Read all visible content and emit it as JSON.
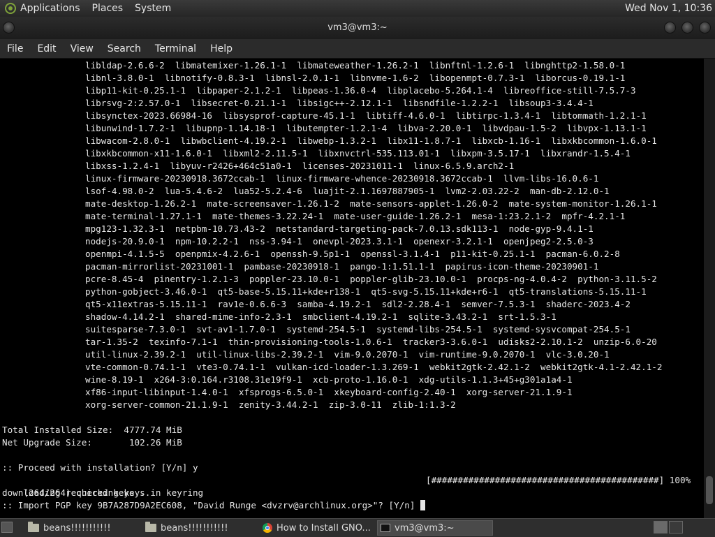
{
  "top_panel": {
    "menus": [
      "Applications",
      "Places",
      "System"
    ],
    "clock": "Wed Nov 1, 10:36"
  },
  "window": {
    "title": "vm3@vm3:~"
  },
  "menubar": [
    "File",
    "Edit",
    "View",
    "Search",
    "Terminal",
    "Help"
  ],
  "terminal": {
    "package_lines": [
      "libldap-2.6.6-2  libmatemixer-1.26.1-1  libmateweather-1.26.2-1  libnftnl-1.2.6-1  libnghttp2-1.58.0-1",
      "libnl-3.8.0-1  libnotify-0.8.3-1  libnsl-2.0.1-1  libnvme-1.6-2  libopenmpt-0.7.3-1  liborcus-0.19.1-1",
      "libp11-kit-0.25.1-1  libpaper-2.1.2-1  libpeas-1.36.0-4  libplacebo-5.264.1-4  libreoffice-still-7.5.7-3",
      "librsvg-2:2.57.0-1  libsecret-0.21.1-1  libsigc++-2.12.1-1  libsndfile-1.2.2-1  libsoup3-3.4.4-1",
      "libsynctex-2023.66984-16  libsysprof-capture-45.1-1  libtiff-4.6.0-1  libtirpc-1.3.4-1  libtommath-1.2.1-1",
      "libunwind-1.7.2-1  libupnp-1.14.18-1  libutempter-1.2.1-4  libva-2.20.0-1  libvdpau-1.5-2  libvpx-1.13.1-1",
      "libwacom-2.8.0-1  libwbclient-4.19.2-1  libwebp-1.3.2-1  libx11-1.8.7-1  libxcb-1.16-1  libxkbcommon-1.6.0-1",
      "libxkbcommon-x11-1.6.0-1  libxml2-2.11.5-1  libxnvctrl-535.113.01-1  libxpm-3.5.17-1  libxrandr-1.5.4-1",
      "libxss-1.2.4-1  libyuv-r2426+464c51a0-1  licenses-20231011-1  linux-6.5.9.arch2-1",
      "linux-firmware-20230918.3672ccab-1  linux-firmware-whence-20230918.3672ccab-1  llvm-libs-16.0.6-1",
      "lsof-4.98.0-2  lua-5.4.6-2  lua52-5.2.4-6  luajit-2.1.1697887905-1  lvm2-2.03.22-2  man-db-2.12.0-1",
      "mate-desktop-1.26.2-1  mate-screensaver-1.26.1-2  mate-sensors-applet-1.26.0-2  mate-system-monitor-1.26.1-1",
      "mate-terminal-1.27.1-1  mate-themes-3.22.24-1  mate-user-guide-1.26.2-1  mesa-1:23.2.1-2  mpfr-4.2.1-1",
      "mpg123-1.32.3-1  netpbm-10.73.43-2  netstandard-targeting-pack-7.0.13.sdk113-1  node-gyp-9.4.1-1",
      "nodejs-20.9.0-1  npm-10.2.2-1  nss-3.94-1  onevpl-2023.3.1-1  openexr-3.2.1-1  openjpeg2-2.5.0-3",
      "openmpi-4.1.5-5  openpmix-4.2.6-1  openssh-9.5p1-1  openssl-3.1.4-1  p11-kit-0.25.1-1  pacman-6.0.2-8",
      "pacman-mirrorlist-20231001-1  pambase-20230918-1  pango-1:1.51.1-1  papirus-icon-theme-20230901-1",
      "pcre-8.45-4  pinentry-1.2.1-3  poppler-23.10.0-1  poppler-glib-23.10.0-1  procps-ng-4.0.4-2  python-3.11.5-2",
      "python-gobject-3.46.0-1  qt5-base-5.15.11+kde+r138-1  qt5-svg-5.15.11+kde+r6-1  qt5-translations-5.15.11-1",
      "qt5-x11extras-5.15.11-1  rav1e-0.6.6-3  samba-4.19.2-1  sdl2-2.28.4-1  semver-7.5.3-1  shaderc-2023.4-2",
      "shadow-4.14.2-1  shared-mime-info-2.3-1  smbclient-4.19.2-1  sqlite-3.43.2-1  srt-1.5.3-1",
      "suitesparse-7.3.0-1  svt-av1-1.7.0-1  systemd-254.5-1  systemd-libs-254.5-1  systemd-sysvcompat-254.5-1",
      "tar-1.35-2  texinfo-7.1-1  thin-provisioning-tools-1.0.6-1  tracker3-3.6.0-1  udisks2-2.10.1-2  unzip-6.0-20",
      "util-linux-2.39.2-1  util-linux-libs-2.39.2-1  vim-9.0.2070-1  vim-runtime-9.0.2070-1  vlc-3.0.20-1",
      "vte-common-0.74.1-1  vte3-0.74.1-1  vulkan-icd-loader-1.3.269-1  webkit2gtk-2.42.1-2  webkit2gtk-4.1-2.42.1-2",
      "wine-8.19-1  x264-3:0.164.r3108.31e19f9-1  xcb-proto-1.16.0-1  xdg-utils-1.1.3+45+g301a1a4-1",
      "xf86-input-libinput-1.4.0-1  xfsprogs-6.5.0-1  xkeyboard-config-2.40-1  xorg-server-21.1.9-1",
      "xorg-server-common-21.1.9-1  zenity-3.44.2-1  zip-3.0-11  zlib-1:1.3-2"
    ],
    "total_installed": "Total Installed Size:  4777.74 MiB",
    "net_upgrade": "Net Upgrade Size:       102.26 MiB",
    "proceed": ":: Proceed with installation? [Y/n] y",
    "checking_keys": "(264/264) checking keys in keyring",
    "progress_bar": "[###########################################] 100%",
    "downloading": "downloading required keys...",
    "import_prompt": ":: Import PGP key 9B7A287D9A2EC608, \"David Runge <dvzrv@archlinux.org>\"? [Y/n] "
  },
  "taskbar": {
    "items": [
      {
        "label": "beans!!!!!!!!!!!",
        "icon": "folder-icon"
      },
      {
        "label": "beans!!!!!!!!!!!",
        "icon": "folder-icon"
      },
      {
        "label": "How to Install GNO...",
        "icon": "chrome-icon"
      },
      {
        "label": "vm3@vm3:~",
        "icon": "terminal-icon"
      }
    ]
  }
}
